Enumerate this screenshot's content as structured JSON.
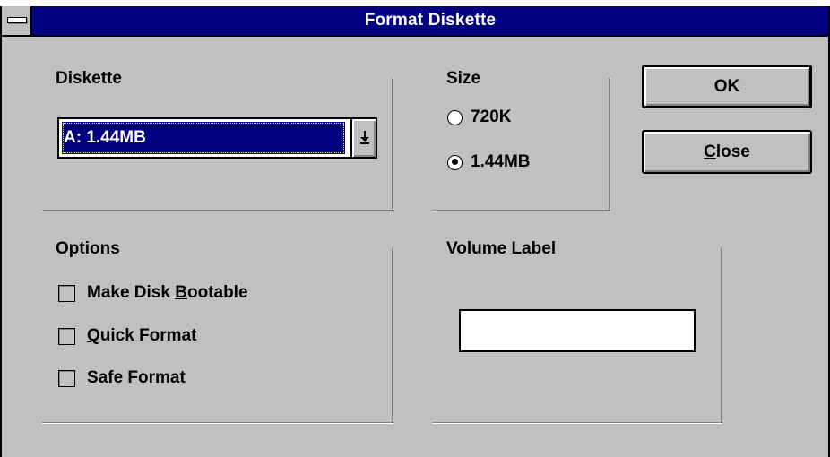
{
  "window": {
    "title": "Format Diskette"
  },
  "diskette": {
    "label": "Diskette",
    "selected": "A: 1.44MB"
  },
  "size": {
    "label": "Size",
    "options": [
      {
        "label": "720K",
        "selected": false
      },
      {
        "label": "1.44MB",
        "selected": true
      }
    ]
  },
  "buttons": {
    "ok": "OK",
    "close_mnemonic": "C",
    "close_rest": "lose"
  },
  "options": {
    "label": "Options",
    "items": [
      {
        "pre": "Make Disk ",
        "mnemonic": "B",
        "post": "ootable",
        "checked": false
      },
      {
        "pre": "",
        "mnemonic": "Q",
        "post": "uick Format",
        "checked": false
      },
      {
        "pre": "",
        "mnemonic": "S",
        "post": "afe Format",
        "checked": false
      }
    ]
  },
  "volume": {
    "label": "Volume Label",
    "value": ""
  },
  "icons": {
    "system_menu": "system-menu-icon",
    "dropdown": "down-arrow-icon"
  },
  "colors": {
    "titlebar": "#000080",
    "face": "#c0c0c0",
    "selection": "#000080"
  }
}
